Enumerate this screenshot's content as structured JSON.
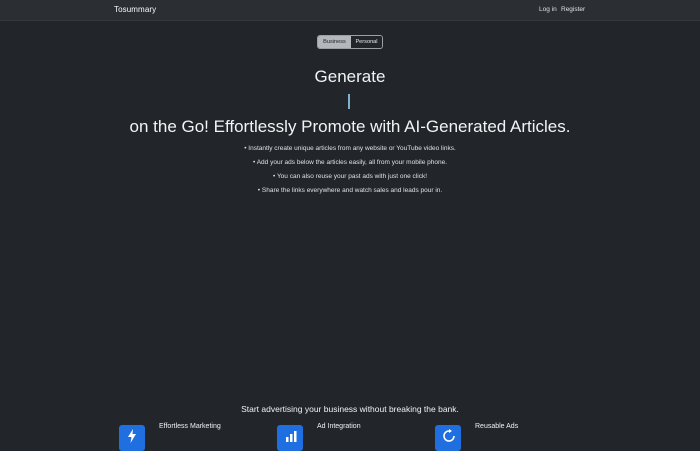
{
  "navbar": {
    "brand": "Tosummary",
    "login": "Log in",
    "register": "Register"
  },
  "toggle": {
    "options": [
      "Business",
      "Personal"
    ],
    "selected": "Business"
  },
  "hero": {
    "line1": "Generate",
    "line2": "on the Go! Effortlessly Promote with AI-Generated Articles."
  },
  "bullets": [
    "Instantly create unique articles from any website or YouTube video links.",
    "Add your ads below the articles easily, all from your mobile phone.",
    "You can also reuse your past ads with just one click!",
    "Share the links everywhere and watch sales and leads pour in."
  ],
  "tagline": "Start advertising your business without breaking the bank.",
  "features": [
    {
      "title": "Effortless Marketing",
      "icon": "bolt-icon"
    },
    {
      "title": "Ad Integration",
      "icon": "chart-icon"
    },
    {
      "title": "Reusable Ads",
      "icon": "refresh-icon"
    }
  ],
  "colors": {
    "background": "#222529",
    "navbar": "#2b2f33",
    "accent_icon": "#1f6fe0",
    "cursor": "#7fb0cc"
  }
}
